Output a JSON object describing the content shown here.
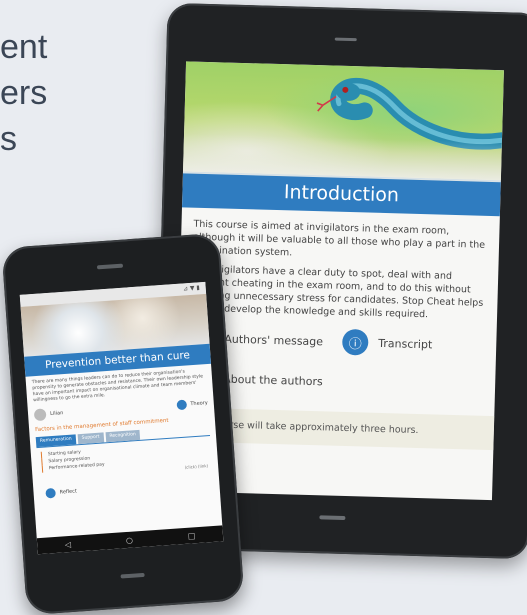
{
  "background_text": [
    "ent",
    "ers",
    "s"
  ],
  "tablet": {
    "title": "Introduction",
    "paragraph_1": "This course is aimed at invigilators in the exam room, although it will be valuable to all those who play a part in the examination system.",
    "paragraph_2": "All invigilators have a clear duty to spot, deal with and prevent cheating in the exam room, and to do this without creating unnecessary stress for candidates. Stop Cheat helps you to develop the knowledge and skills required.",
    "links": {
      "authors_message": "Authors' message",
      "transcript": "Transcript",
      "about_authors": "About the authors"
    },
    "notice": "This course will take approximately three hours."
  },
  "phone": {
    "status": "⊿ ▼ ▮",
    "title": "Prevention better than cure",
    "paragraph": "There are many things leaders can do to reduce their organisation's propensity to generate obstacles and resistance. Their own leadership style have an important impact on organisational climate and team members' willingness to go the extra mile.",
    "persona_1": "Lilian",
    "persona_2": "Theory",
    "factors_title": "Factors in the management of staff commitment",
    "tabs": [
      "Remuneration",
      "Support",
      "Recognition"
    ],
    "tab_items": [
      "Starting salary",
      "Salary progression",
      "Performance-related pay"
    ],
    "tab_footer": "(click) (link)",
    "reflect": "Reflect",
    "nav": [
      "◁",
      "○",
      "□"
    ]
  },
  "colors": {
    "accent": "#2f7cc0",
    "orange": "#e07a2e",
    "device": "#202224",
    "background": "#e9ecf1"
  }
}
